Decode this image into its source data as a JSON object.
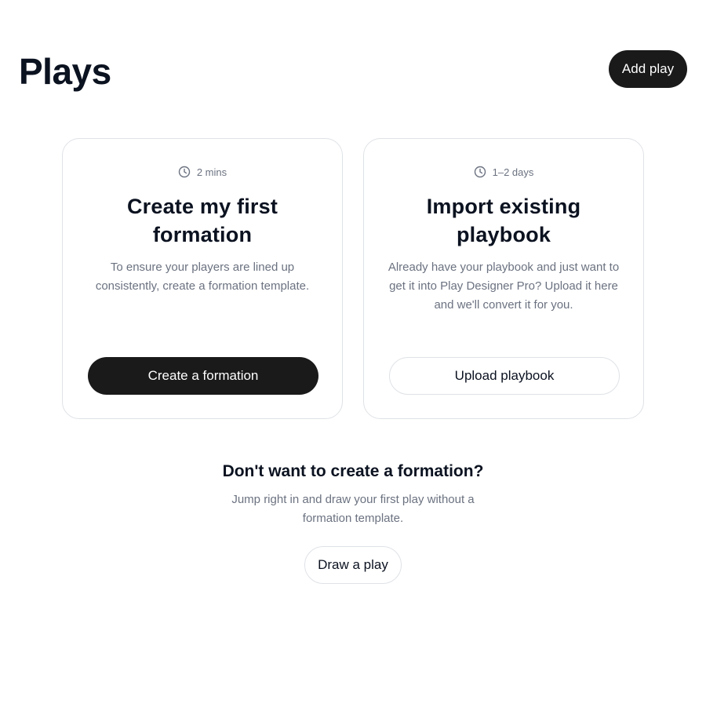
{
  "header": {
    "title": "Plays",
    "add_button_label": "Add play"
  },
  "cards": [
    {
      "duration": "2 mins",
      "duration_icon": "clock-icon",
      "title": "Create my first formation",
      "description": "To ensure your players are lined up consistently, create a formation template.",
      "button_label": "Create a formation",
      "button_style": "primary"
    },
    {
      "duration": "1–2 days",
      "duration_icon": "clock-icon",
      "title": "Import existing playbook",
      "description": "Already have your playbook and just want to get it into Play Designer Pro? Upload it here and we'll convert it for you.",
      "button_label": "Upload playbook",
      "button_style": "secondary"
    }
  ],
  "alternative": {
    "title": "Don't want to create a formation?",
    "description": "Jump right in and draw your first play without a formation template.",
    "button_label": "Draw a play"
  },
  "colors": {
    "primary_button": "#1a1a1a",
    "heading_text": "#0b1220",
    "muted_text": "#6b7280",
    "border": "#dfe2e6"
  }
}
